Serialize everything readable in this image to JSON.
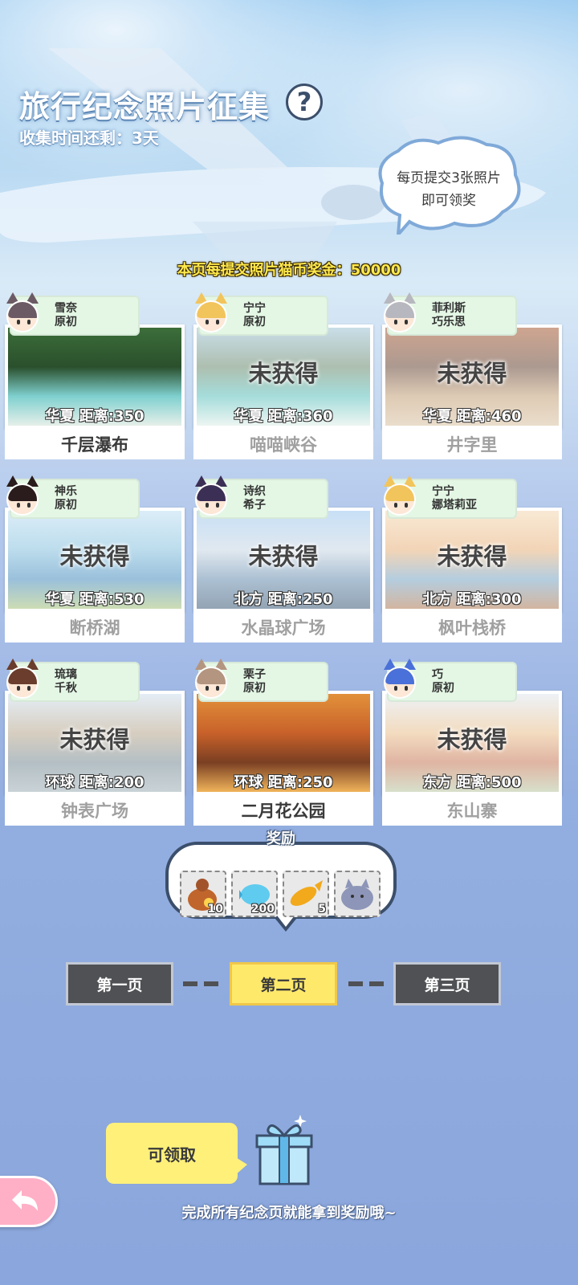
{
  "header": {
    "title": "旅行纪念照片征集",
    "help": "?",
    "timer": "收集时间还剩：3天",
    "bubble_line1": "每页提交3张照片",
    "bubble_line2": "即可领奖",
    "bonus": "本页每提交照片猫币奖金：50000"
  },
  "cards": [
    {
      "name1": "雪奈",
      "name2": "原初",
      "region": "华夏",
      "distance": "距离:350",
      "place": "千层瀑布",
      "obtained": true,
      "locked_text": "",
      "hair": "#6b5a64",
      "scene": [
        "#3c6e3a",
        "#2a4f2c",
        "#7fd0cf",
        "#e6efe9"
      ]
    },
    {
      "name1": "宁宁",
      "name2": "原初",
      "region": "华夏",
      "distance": "距离:360",
      "place": "喵喵峡谷",
      "obtained": false,
      "locked_text": "未获得",
      "hair": "#f2c45c",
      "scene": [
        "#9fc4d6",
        "#6e8d71",
        "#5fc2bf",
        "#dfeee8"
      ]
    },
    {
      "name1": "菲利斯",
      "name2": "巧乐思",
      "region": "华夏",
      "distance": "距离:460",
      "place": "井字里",
      "obtained": false,
      "locked_text": "未获得",
      "hair": "#b7b8bf",
      "scene": [
        "#a85f3a",
        "#6b4a3a",
        "#c4a27a",
        "#d9c3a3"
      ]
    },
    {
      "name1": "神乐",
      "name2": "原初",
      "region": "华夏",
      "distance": "距离:530",
      "place": "断桥湖",
      "obtained": false,
      "locked_text": "未获得",
      "hair": "#2a1c1c",
      "scene": [
        "#bfe0f2",
        "#88c1de",
        "#4b8fbf",
        "#a6c27a"
      ]
    },
    {
      "name1": "诗织",
      "name2": "希子",
      "region": "北方",
      "distance": "距离:250",
      "place": "水晶球广场",
      "obtained": false,
      "locked_text": "未获得",
      "hair": "#3b2f55",
      "scene": [
        "#9cc7ef",
        "#c9d7e4",
        "#6a8fb0",
        "#3f5d79"
      ]
    },
    {
      "name1": "宁宁",
      "name2": "娜塔莉亚",
      "region": "北方",
      "distance": "距离:300",
      "place": "枫叶栈桥",
      "obtained": false,
      "locked_text": "未获得",
      "hair": "#f2c45c",
      "scene": [
        "#f3d8b3",
        "#e8b37e",
        "#7aa6c7",
        "#b07c55"
      ]
    },
    {
      "name1": "琉璃",
      "name2": "千秋",
      "region": "环球",
      "distance": "距离:200",
      "place": "钟表广场",
      "obtained": false,
      "locked_text": "未获得",
      "hair": "#6a3d2c",
      "scene": [
        "#cfe0ee",
        "#b8a88f",
        "#7a8d97",
        "#9fb0b7"
      ]
    },
    {
      "name1": "栗子",
      "name2": "原初",
      "region": "环球",
      "distance": "距离:250",
      "place": "二月花公园",
      "obtained": true,
      "locked_text": "",
      "hair": "#b39580",
      "scene": [
        "#e2913a",
        "#c8612a",
        "#7a3f22",
        "#f0b45a"
      ]
    },
    {
      "name1": "巧",
      "name2": "原初",
      "region": "东方",
      "distance": "距离:500",
      "place": "东山寨",
      "obtained": false,
      "locked_text": "未获得",
      "hair": "#4a70d9",
      "scene": [
        "#dfe7ee",
        "#e9c08e",
        "#c77a5a",
        "#b8c7a3"
      ]
    }
  ],
  "rewards": {
    "title": "奖励",
    "items": [
      {
        "icon": "coin-bag-icon",
        "count": "10"
      },
      {
        "icon": "blue-fish-candy-icon",
        "count": "200"
      },
      {
        "icon": "golden-fish-icon",
        "count": "5"
      },
      {
        "icon": "cat-plush-icon",
        "count": ""
      }
    ]
  },
  "pages": [
    "第一页",
    "第二页",
    "第三页"
  ],
  "active_page": 1,
  "claim_label": "可领取",
  "footer": "完成所有纪念页就能拿到奖励哦~",
  "colors": {
    "active_page": "#ffe96b",
    "page_btn": "#4f5154",
    "tag_bg": "#e4f7e5"
  }
}
